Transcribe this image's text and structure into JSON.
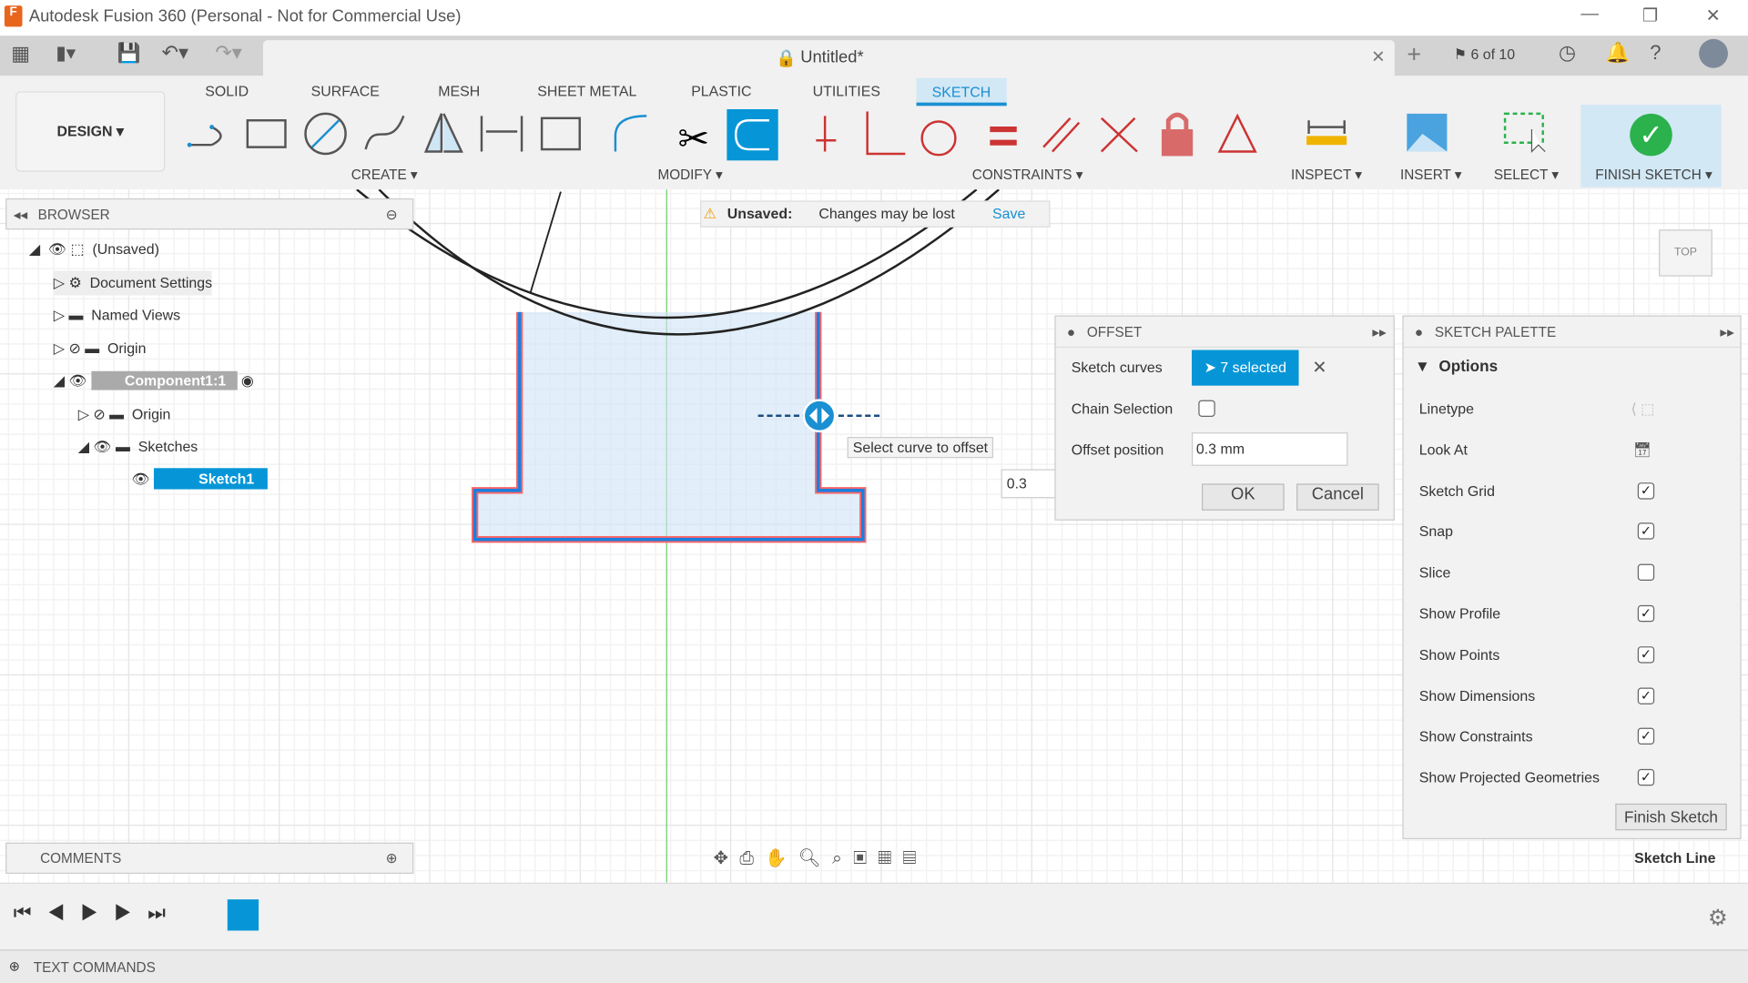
{
  "window": {
    "title": "Autodesk Fusion 360 (Personal - Not for Commercial Use)"
  },
  "document": {
    "tab_title": "Untitled*",
    "job_count": "6 of 10"
  },
  "workspace": "DESIGN",
  "tabs": [
    "SOLID",
    "SURFACE",
    "MESH",
    "SHEET METAL",
    "PLASTIC",
    "UTILITIES",
    "SKETCH"
  ],
  "active_tab": "SKETCH",
  "groups": {
    "create": "CREATE",
    "modify": "MODIFY",
    "constraints": "CONSTRAINTS",
    "inspect": "INSPECT",
    "insert": "INSERT",
    "select": "SELECT",
    "finish": "FINISH SKETCH"
  },
  "browser": {
    "title": "BROWSER",
    "items": [
      "(Unsaved)",
      "Document Settings",
      "Named Views",
      "Origin",
      "Component1:1",
      "Origin",
      "Sketches",
      "Sketch1"
    ]
  },
  "unsaved": {
    "label": "Unsaved:",
    "message": "Changes may be lost",
    "save": "Save"
  },
  "offset": {
    "title": "OFFSET",
    "sketch_curves_label": "Sketch curves",
    "selected": "7 selected",
    "chain_label": "Chain Selection",
    "chain_checked": false,
    "position_label": "Offset position",
    "position_value": "0.3 mm",
    "ok": "OK",
    "cancel": "Cancel"
  },
  "canvas": {
    "tooltip": "Select curve to offset",
    "inline_value": "0.3",
    "viewcube": "TOP",
    "status": "Sketch Line"
  },
  "palette": {
    "title": "SKETCH PALETTE",
    "section": "Options",
    "rows": [
      {
        "label": "Linetype"
      },
      {
        "label": "Look At"
      },
      {
        "label": "Sketch Grid",
        "checked": true
      },
      {
        "label": "Snap",
        "checked": true
      },
      {
        "label": "Slice",
        "checked": false
      },
      {
        "label": "Show Profile",
        "checked": true
      },
      {
        "label": "Show Points",
        "checked": true
      },
      {
        "label": "Show Dimensions",
        "checked": true
      },
      {
        "label": "Show Constraints",
        "checked": true
      },
      {
        "label": "Show Projected Geometries",
        "checked": true
      }
    ],
    "finish": "Finish Sketch"
  },
  "comments": "COMMENTS",
  "text_commands": "TEXT COMMANDS",
  "colors": {
    "accent": "#0696d7",
    "finish_green": "#2bb24c",
    "selection_red": "#ff5555"
  }
}
